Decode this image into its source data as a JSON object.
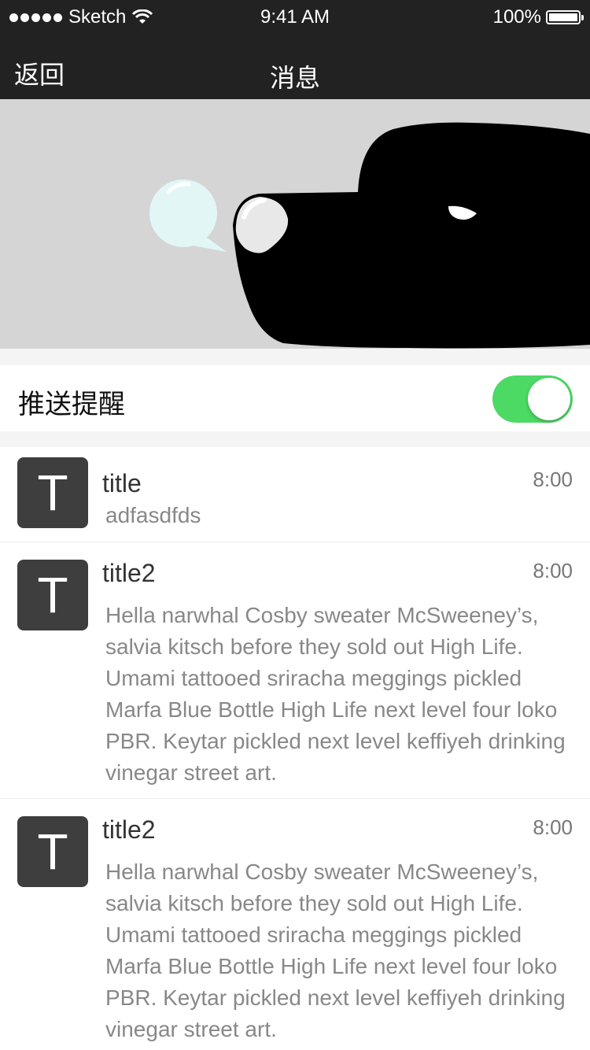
{
  "status_bar": {
    "carrier": "Sketch",
    "time": "9:41 AM",
    "battery": "100%"
  },
  "nav": {
    "back_label": "返回",
    "title": "消息"
  },
  "push_setting": {
    "label": "推送提醒",
    "enabled": true
  },
  "colors": {
    "bar": "#222222",
    "toggle_on": "#4cd964",
    "avatar": "#3e3e3e"
  },
  "messages": [
    {
      "avatar_letter": "T",
      "title": "title",
      "time": "8:00",
      "body": "adfasdfds"
    },
    {
      "avatar_letter": "T",
      "title": "title2",
      "time": "8:00",
      "body": "Hella narwhal Cosby sweater McSweeney’s, salvia kitsch before they sold out High Life. Umami tattooed sriracha meggings pickled Marfa Blue Bottle High Life next level four loko PBR. Keytar pickled next level keffiyeh drinking vinegar street art."
    },
    {
      "avatar_letter": "T",
      "title": "title2",
      "time": "8:00",
      "body": "Hella narwhal Cosby sweater McSweeney’s, salvia kitsch before they sold out High Life. Umami tattooed sriracha meggings pickled Marfa Blue Bottle High Life next level four loko PBR. Keytar pickled next level keffiyeh drinking vinegar street art."
    }
  ]
}
